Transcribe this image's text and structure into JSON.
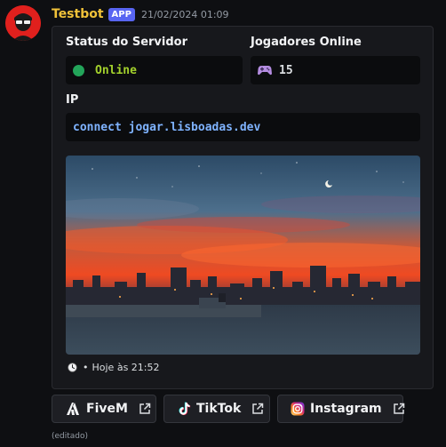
{
  "message": {
    "username": "Testbot",
    "badge": "APP",
    "timestamp": "21/02/2024 01:09",
    "edited": "(editado)"
  },
  "embed": {
    "fields": [
      {
        "name": "Status do Servidor",
        "value": "Online",
        "icon": "status-dot"
      },
      {
        "name": "Jogadores Online",
        "value": "15",
        "icon": "gamepad-icon"
      },
      {
        "name": "IP",
        "value": "connect jogar.lisboadas.dev"
      }
    ],
    "footer": {
      "icon": "clock-icon",
      "text": "Hoje às 21:52"
    }
  },
  "buttons": [
    {
      "label": "FiveM",
      "icon": "fivem-icon"
    },
    {
      "label": "TikTok",
      "icon": "tiktok-icon"
    },
    {
      "label": "Instagram",
      "icon": "instagram-icon"
    }
  ],
  "colors": {
    "username": "#f0c239",
    "badge": "#5865f2",
    "online_dot": "#23a55a",
    "online_text": "#a3d12c",
    "link_code": "#7fb3ff"
  }
}
